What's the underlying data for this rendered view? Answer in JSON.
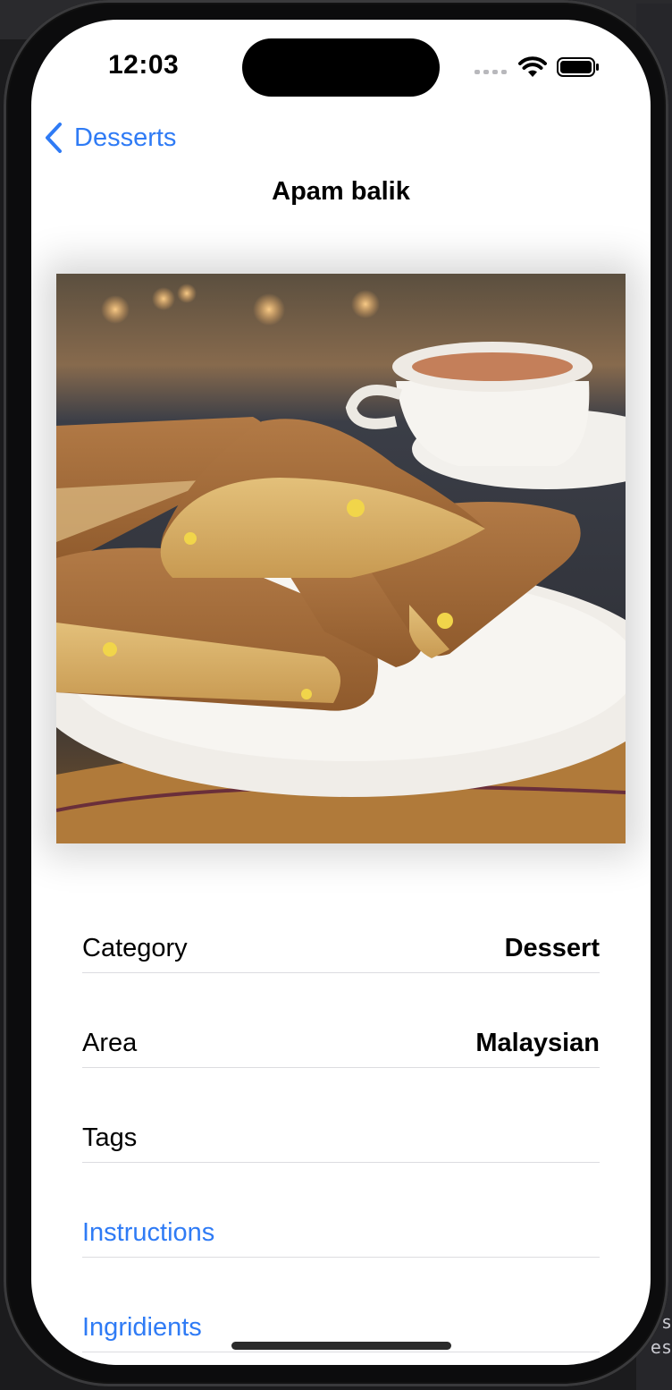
{
  "status_bar": {
    "time": "12:03",
    "signal_icon": "signal-bars-icon",
    "wifi_icon": "wifi-icon",
    "battery_icon": "battery-icon"
  },
  "nav": {
    "back_label": "Desserts",
    "back_icon": "chevron-left-icon",
    "title": "Apam balik"
  },
  "photo": {
    "subject": "apam-balik-pancake-photo"
  },
  "details": [
    {
      "label": "Category",
      "value": "Dessert"
    },
    {
      "label": "Area",
      "value": "Malaysian"
    },
    {
      "label": "Tags",
      "value": ""
    }
  ],
  "links": [
    {
      "label": "Instructions"
    },
    {
      "label": "Ingridients"
    }
  ],
  "background_edge_text": [
    "s",
    "es"
  ],
  "colors": {
    "accent": "#2f7bf5",
    "text": "#000000",
    "background": "#ffffff",
    "separator": "#dcdce0"
  }
}
